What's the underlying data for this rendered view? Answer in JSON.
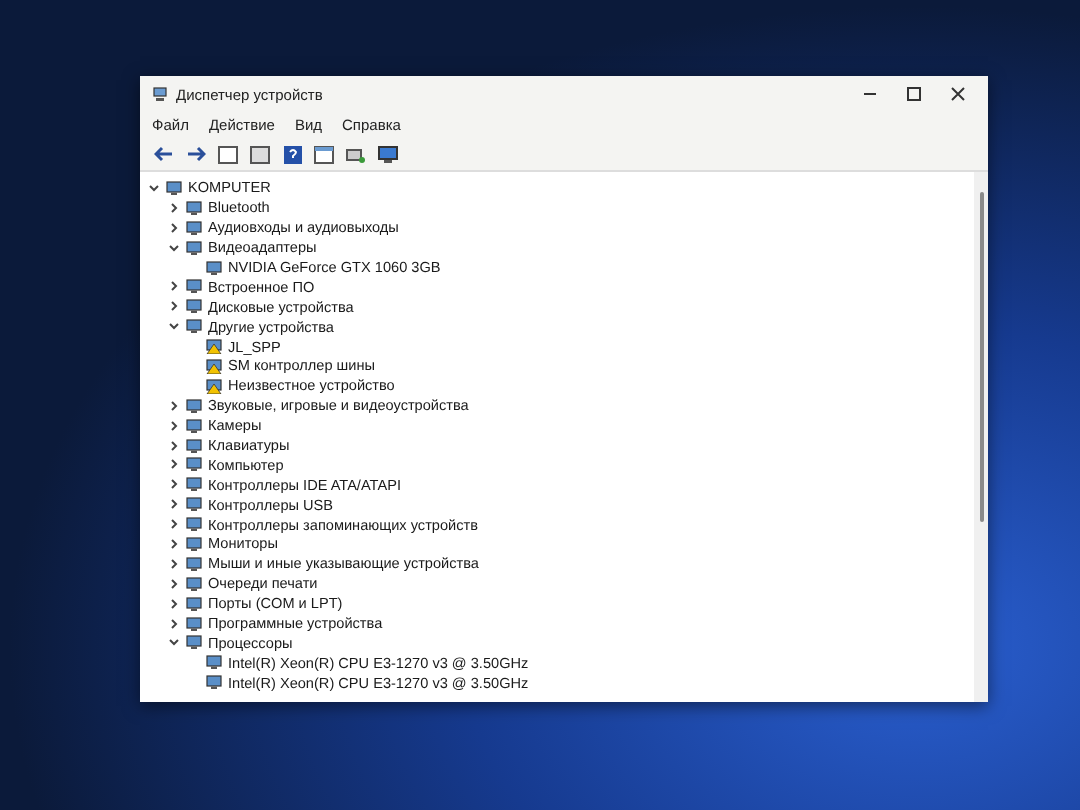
{
  "window": {
    "title": "Диспетчер устройств"
  },
  "menu": [
    "Файл",
    "Действие",
    "Вид",
    "Справка"
  ],
  "tree": {
    "label": "KOMPUTER",
    "expanded": true,
    "children": [
      {
        "label": "Bluetooth",
        "expanded": false
      },
      {
        "label": "Аудиовходы и аудиовыходы",
        "expanded": false
      },
      {
        "label": "Видеоадаптеры",
        "expanded": true,
        "children": [
          {
            "label": "NVIDIA GeForce GTX 1060 3GB"
          }
        ]
      },
      {
        "label": "Встроенное ПО",
        "expanded": false
      },
      {
        "label": "Дисковые устройства",
        "expanded": false
      },
      {
        "label": "Другие устройства",
        "expanded": true,
        "children": [
          {
            "label": "JL_SPP",
            "problem": true
          },
          {
            "label": "SM контроллер шины",
            "problem": true
          },
          {
            "label": "Неизвестное устройство",
            "problem": true
          }
        ]
      },
      {
        "label": "Звуковые, игровые и видеоустройства",
        "expanded": false
      },
      {
        "label": "Камеры",
        "expanded": false
      },
      {
        "label": "Клавиатуры",
        "expanded": false
      },
      {
        "label": "Компьютер",
        "expanded": false
      },
      {
        "label": "Контроллеры IDE ATA/ATAPI",
        "expanded": false
      },
      {
        "label": "Контроллеры USB",
        "expanded": false
      },
      {
        "label": "Контроллеры запоминающих устройств",
        "expanded": false
      },
      {
        "label": "Мониторы",
        "expanded": false
      },
      {
        "label": "Мыши и иные указывающие устройства",
        "expanded": false
      },
      {
        "label": "Очереди печати",
        "expanded": false
      },
      {
        "label": "Порты (COM и LPT)",
        "expanded": false
      },
      {
        "label": "Программные устройства",
        "expanded": false
      },
      {
        "label": "Процессоры",
        "expanded": true,
        "children": [
          {
            "label": "Intel(R) Xeon(R) CPU E3-1270 v3 @ 3.50GHz"
          },
          {
            "label": "Intel(R) Xeon(R) CPU E3-1270 v3 @ 3.50GHz"
          }
        ]
      }
    ]
  }
}
